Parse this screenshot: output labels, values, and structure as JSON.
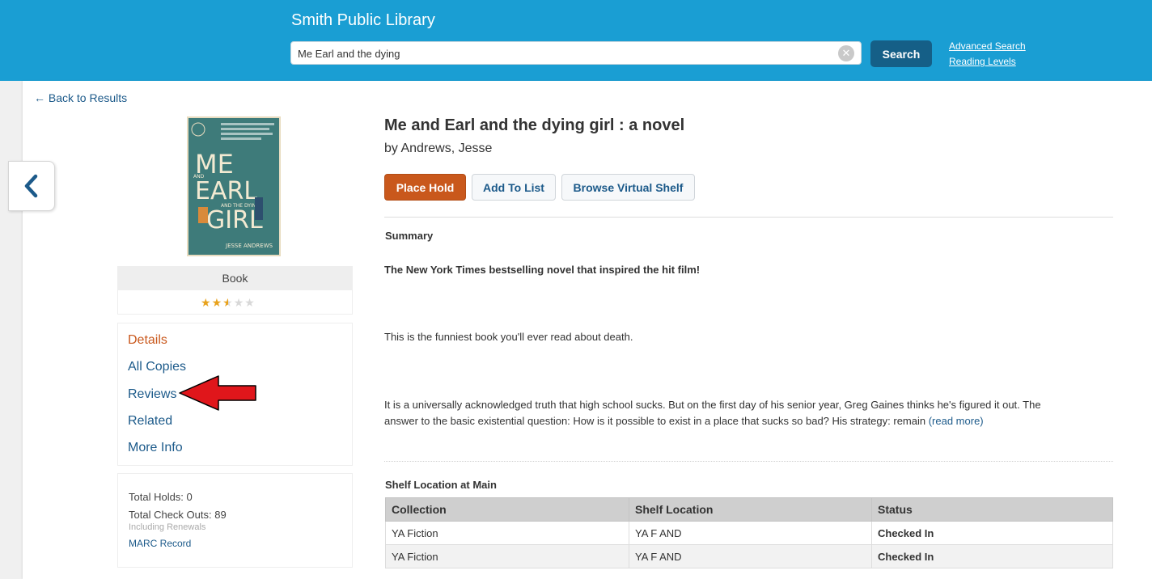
{
  "header": {
    "site_title": "Smith Public Library",
    "search_value": "Me Earl and the dying",
    "search_button": "Search",
    "advanced_search": "Advanced Search",
    "reading_levels": "Reading Levels"
  },
  "back_link": "← Back to Results",
  "cover": {
    "line1": "ME",
    "line2": "EARL",
    "line3": "GIRL",
    "small1": "AND",
    "small2": "AND THE DYING",
    "author_credit": "JESSE ANDREWS"
  },
  "format": "Book",
  "rating": {
    "value": 2.5,
    "max": 5
  },
  "nav": {
    "details": "Details",
    "all_copies": "All Copies",
    "reviews": "Reviews",
    "related": "Related",
    "more_info": "More Info"
  },
  "stats": {
    "total_holds": "Total Holds: 0",
    "total_checkouts": "Total Check Outs: 89",
    "including_renewals": "Including Renewals",
    "marc_record": "MARC Record"
  },
  "book": {
    "title": "Me and Earl and the dying girl : a novel",
    "author": "by Andrews, Jesse"
  },
  "actions": {
    "place_hold": "Place Hold",
    "add_to_list": "Add To List",
    "browse_shelf": "Browse Virtual Shelf"
  },
  "summary": {
    "heading": "Summary",
    "tagline": "The New York Times bestselling novel that inspired the hit film!",
    "para1": "This is the funniest book you'll ever read about death.",
    "para2_line1": "It is a universally acknowledged truth that high school sucks. But on the first day of his senior year, Greg Gaines thinks he's figured it out. The",
    "para2_line2": "answer to the basic existential question: How is it possible to exist in a place that sucks so bad? His strategy: remain ",
    "read_more": "(read more)"
  },
  "shelf": {
    "heading": "Shelf Location at Main",
    "columns": [
      "Collection",
      "Shelf Location",
      "Status"
    ],
    "rows": [
      [
        "YA Fiction",
        "YA F AND",
        "Checked In"
      ],
      [
        "YA Fiction",
        "YA F AND",
        "Checked In"
      ]
    ]
  },
  "colors": {
    "header_bg": "#1a9ed3",
    "accent_orange": "#c9581c",
    "link_blue": "#1c5a8a",
    "status_green": "#3aa52a"
  }
}
